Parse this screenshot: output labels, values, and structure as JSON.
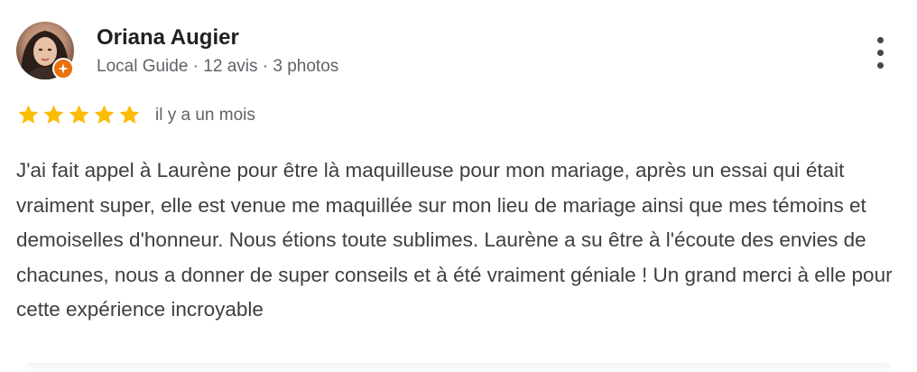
{
  "review": {
    "author_name": "Oriana Augier",
    "author_meta": "Local Guide · 12 avis · 3 photos",
    "rating": 5,
    "max_rating": 5,
    "time_ago": "il y a un mois",
    "text": "J'ai fait appel à Laurène pour être là maquilleuse pour mon mariage, après un essai qui était vraiment super, elle est venue me maquillée sur mon lieu de mariage ainsi que mes témoins et demoiselles d'honneur. Nous étions toute sublimes. Laurène a su être à l'écoute des envies de chacunes, nous a donner de super conseils et à été vraiment géniale ! Un grand merci à elle pour cette expérience incroyable"
  },
  "colors": {
    "star": "#fbbc04",
    "guide_badge": "#e8710a",
    "text_primary": "#202124",
    "text_secondary": "#5f6368",
    "body_text": "#3c4043"
  },
  "icons": {
    "avatar": "user-avatar",
    "badge": "local-guide-badge-icon",
    "menu": "more-vert-icon",
    "star": "star-icon"
  }
}
